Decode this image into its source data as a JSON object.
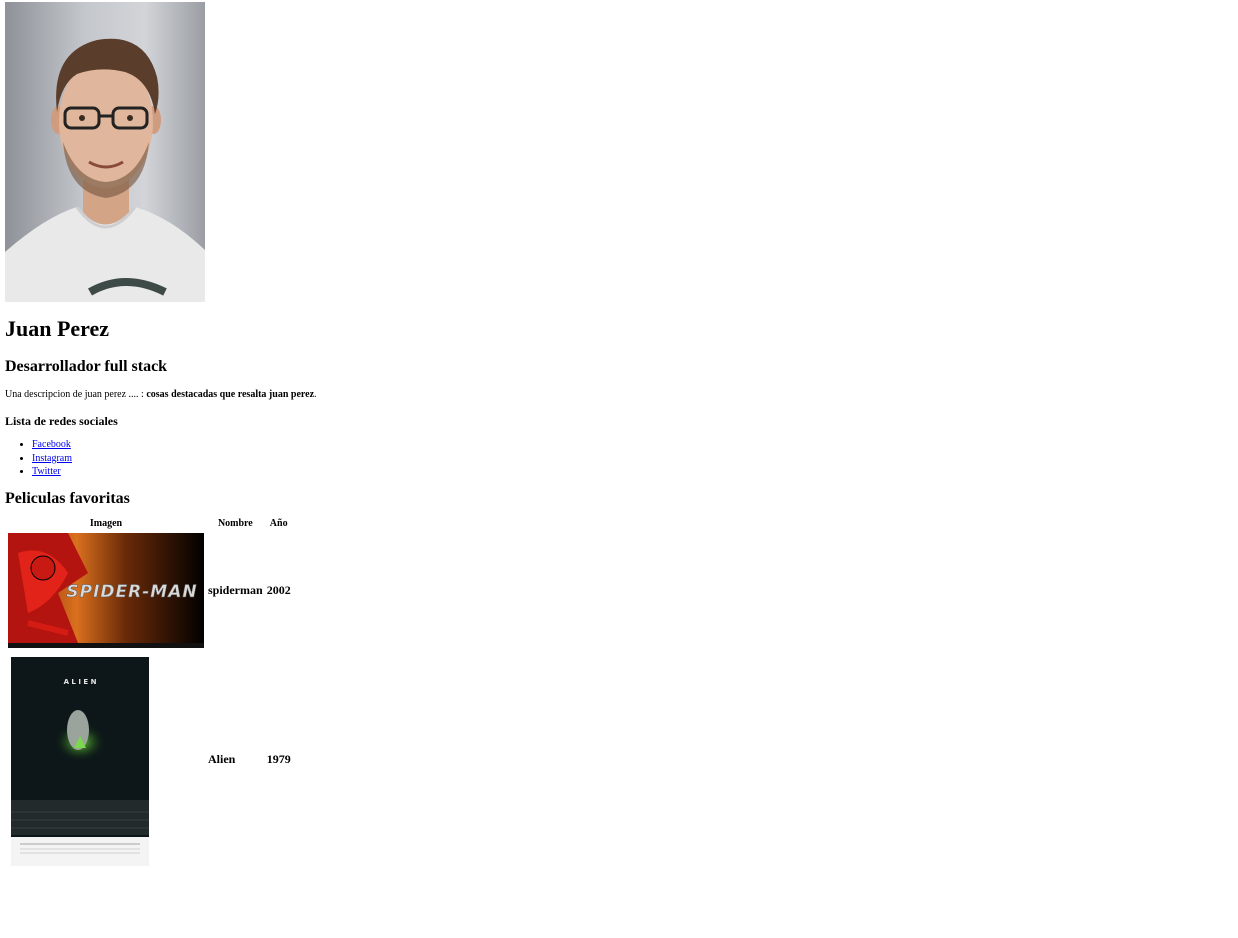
{
  "profile": {
    "photo_alt": "Juan Perez",
    "name": "Juan Perez",
    "title": "Desarrollador full stack",
    "description_prefix": "Una descripcion de juan perez .... : ",
    "description_highlight": "cosas destacadas que resalta juan perez",
    "description_suffix": "."
  },
  "social": {
    "heading": "Lista de redes sociales",
    "links": [
      {
        "label": "Facebook"
      },
      {
        "label": "Instagram"
      },
      {
        "label": "Twitter"
      }
    ]
  },
  "movies": {
    "heading": "Peliculas favoritas",
    "columns": [
      "Imagen",
      "Nombre",
      "Año"
    ],
    "rows": [
      {
        "poster": "spiderman-poster",
        "name": "spiderman",
        "year": "2002",
        "poster_text": "SPIDER-MAN"
      },
      {
        "poster": "alien-poster",
        "name": "Alien",
        "year": "1979",
        "poster_text": "A L I E N"
      }
    ]
  },
  "colors": {
    "link": "#0000ee",
    "text": "#000000",
    "background": "#ffffff"
  }
}
